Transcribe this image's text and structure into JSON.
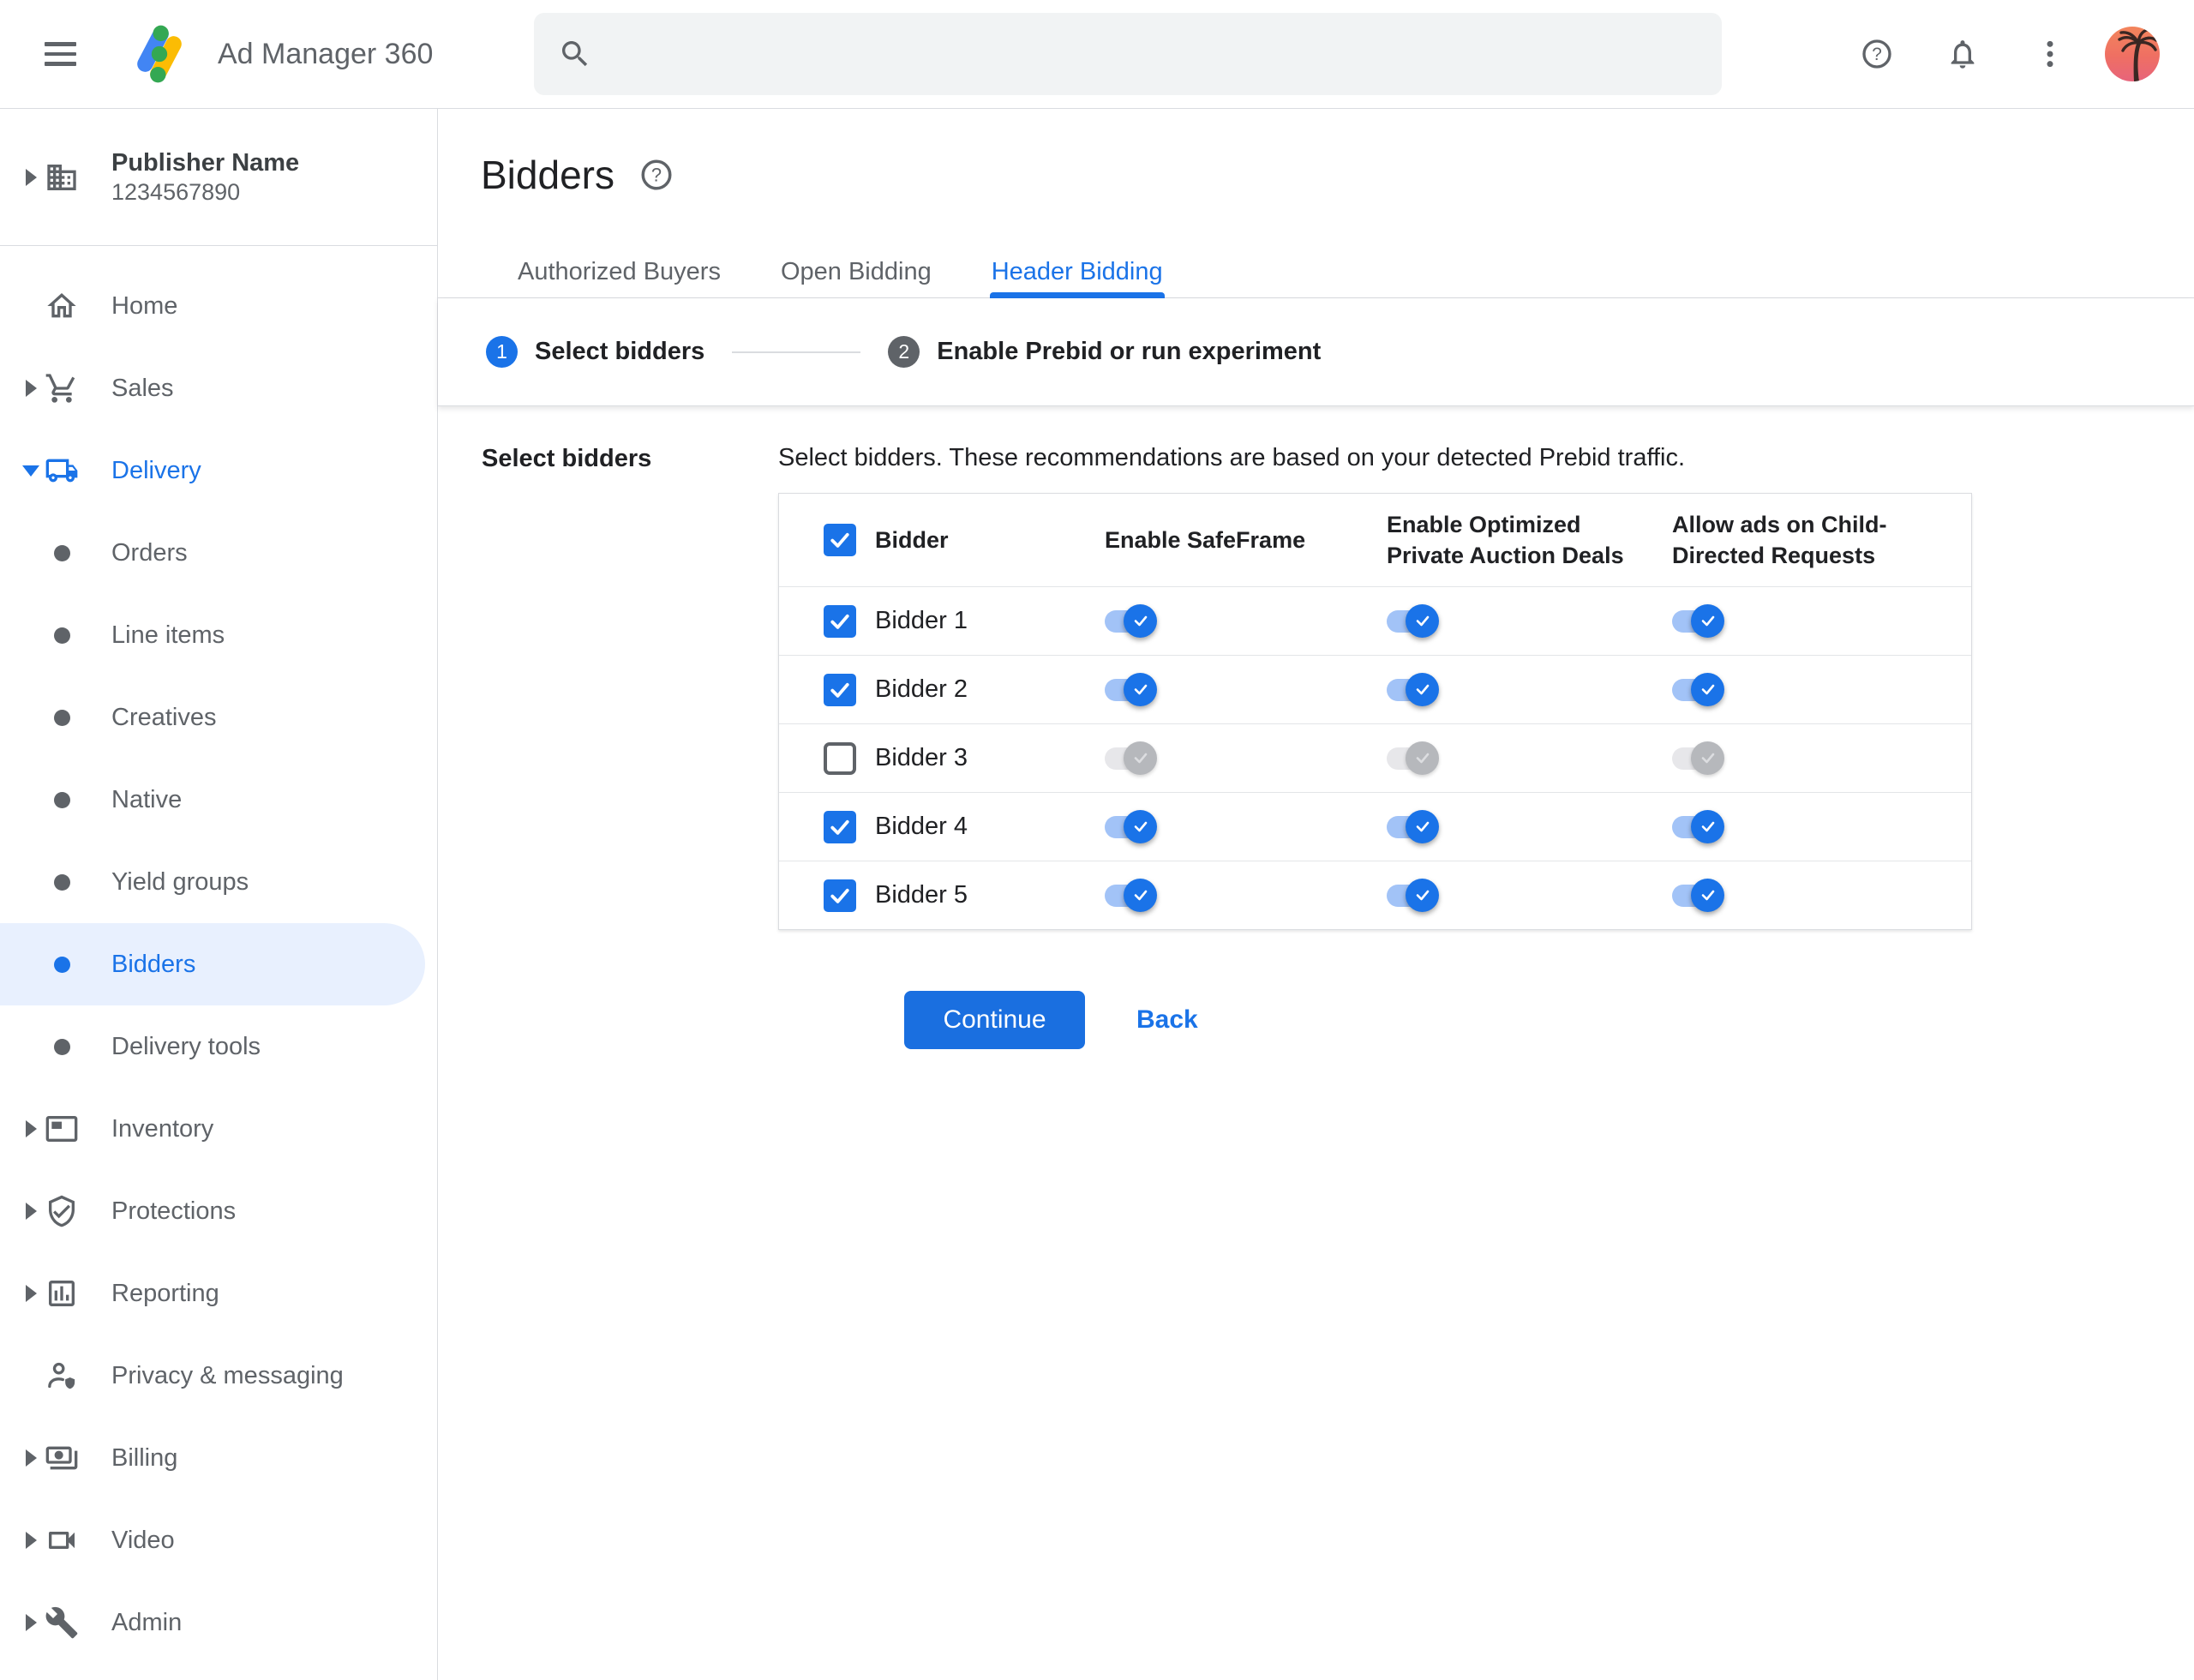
{
  "topbar": {
    "app_name": "Ad Manager 360",
    "search_placeholder": "",
    "search_value": ""
  },
  "sidebar": {
    "publisher": {
      "name": "Publisher Name",
      "id": "1234567890"
    },
    "items": [
      {
        "label": "Home"
      },
      {
        "label": "Sales"
      },
      {
        "label": "Delivery"
      },
      {
        "label": "Orders"
      },
      {
        "label": "Line items"
      },
      {
        "label": "Creatives"
      },
      {
        "label": "Native"
      },
      {
        "label": "Yield groups"
      },
      {
        "label": "Bidders"
      },
      {
        "label": "Delivery tools"
      },
      {
        "label": "Inventory"
      },
      {
        "label": "Protections"
      },
      {
        "label": "Reporting"
      },
      {
        "label": "Privacy & messaging"
      },
      {
        "label": "Billing"
      },
      {
        "label": "Video"
      },
      {
        "label": "Admin"
      }
    ],
    "selected_item": "Bidders",
    "expanded_section": "Delivery"
  },
  "page": {
    "title": "Bidders",
    "tabs": [
      {
        "label": "Authorized Buyers"
      },
      {
        "label": "Open Bidding"
      },
      {
        "label": "Header Bidding"
      }
    ],
    "active_tab": "Header Bidding",
    "steps": [
      {
        "num": "1",
        "label": "Select bidders",
        "active": true
      },
      {
        "num": "2",
        "label": "Enable Prebid or run experiment",
        "active": false
      }
    ],
    "section_label": "Select bidders",
    "description": "Select bidders. These recommendations are based on your detected Prebid traffic.",
    "table": {
      "header_checkbox_checked": true,
      "headers": {
        "bidder": "Bidder",
        "safeframe": "Enable SafeFrame",
        "optimized": "Enable Optimized Private Auction Deals",
        "child_directed": "Allow ads on Child-Directed Requests"
      },
      "rows": [
        {
          "name": "Bidder 1",
          "selected": true,
          "safeframe": true,
          "optimized": true,
          "child_directed": true
        },
        {
          "name": "Bidder 2",
          "selected": true,
          "safeframe": true,
          "optimized": true,
          "child_directed": true
        },
        {
          "name": "Bidder 3",
          "selected": false,
          "safeframe": true,
          "optimized": true,
          "child_directed": true
        },
        {
          "name": "Bidder 4",
          "selected": true,
          "safeframe": true,
          "optimized": true,
          "child_directed": true
        },
        {
          "name": "Bidder 5",
          "selected": true,
          "safeframe": true,
          "optimized": true,
          "child_directed": true
        }
      ]
    },
    "buttons": {
      "continue": "Continue",
      "back": "Back"
    },
    "colors": {
      "accent": "#1a73e8",
      "selected_bg": "#e8f0fe",
      "toggle_track": "#a2c3f7"
    }
  }
}
